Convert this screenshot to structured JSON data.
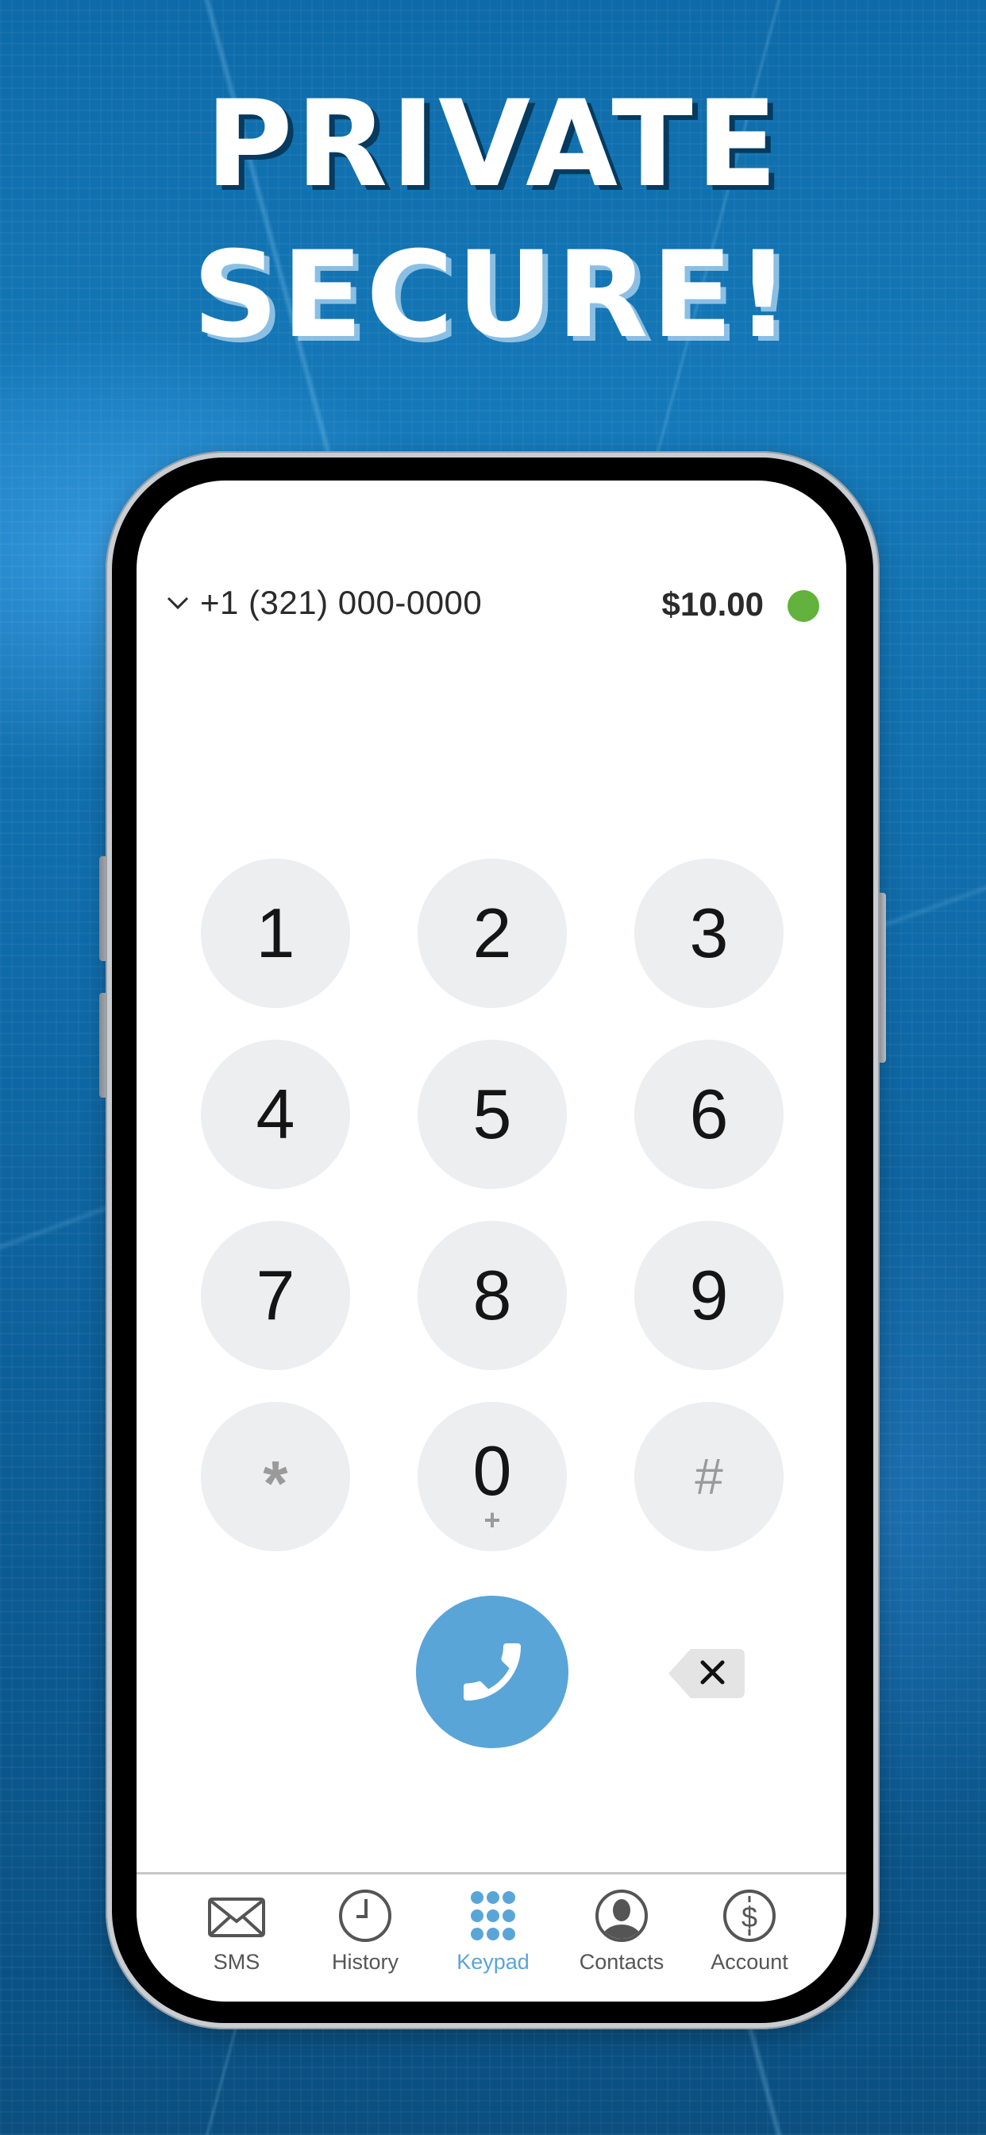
{
  "headline": {
    "line1": "PRIVATE",
    "line2": "SECURE!"
  },
  "header": {
    "phone_number": "+1 (321) 000-0000",
    "balance": "$10.00",
    "status": "online",
    "status_color": "#62b23d"
  },
  "keypad": {
    "keys": [
      {
        "digit": "1",
        "sub": ""
      },
      {
        "digit": "2",
        "sub": ""
      },
      {
        "digit": "3",
        "sub": ""
      },
      {
        "digit": "4",
        "sub": ""
      },
      {
        "digit": "5",
        "sub": ""
      },
      {
        "digit": "6",
        "sub": ""
      },
      {
        "digit": "7",
        "sub": ""
      },
      {
        "digit": "8",
        "sub": ""
      },
      {
        "digit": "9",
        "sub": ""
      },
      {
        "digit": "*",
        "sub": ""
      },
      {
        "digit": "0",
        "sub": "+"
      },
      {
        "digit": "#",
        "sub": ""
      }
    ],
    "call_color": "#5aa5d8",
    "key_color": "#edeef0"
  },
  "tabbar": {
    "active": "Keypad",
    "accent_color": "#5aa5d8",
    "tabs": [
      {
        "label": "SMS",
        "icon": "envelope-icon"
      },
      {
        "label": "History",
        "icon": "clock-icon"
      },
      {
        "label": "Keypad",
        "icon": "keypad-icon"
      },
      {
        "label": "Contacts",
        "icon": "contact-icon"
      },
      {
        "label": "Account",
        "icon": "dollar-icon"
      }
    ]
  }
}
